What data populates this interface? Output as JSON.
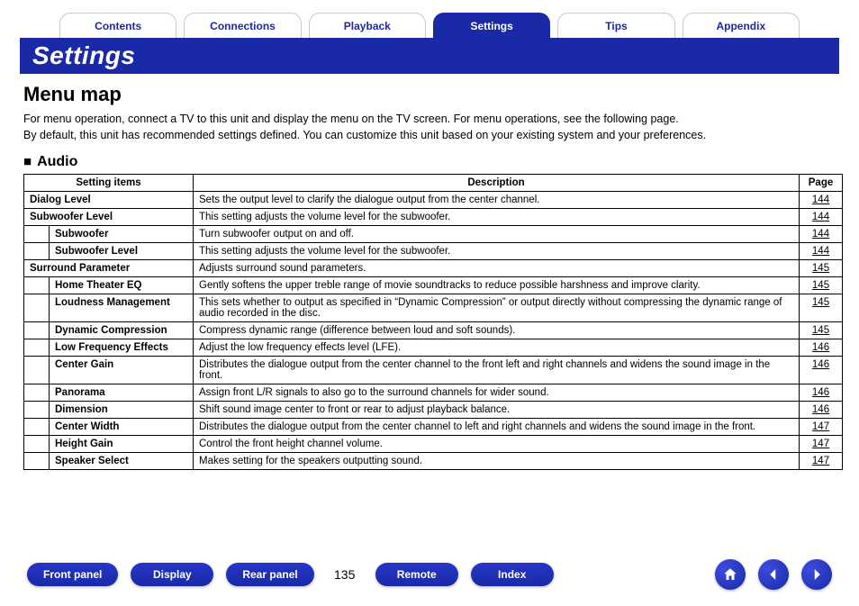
{
  "tabs": {
    "contents": "Contents",
    "connections": "Connections",
    "playback": "Playback",
    "settings": "Settings",
    "tips": "Tips",
    "appendix": "Appendix",
    "active": "settings"
  },
  "title_band": "Settings",
  "section_title": "Menu map",
  "intro_line1": "For menu operation, connect a TV to this unit and display the menu on the TV screen. For menu operations, see the following page.",
  "intro_line2": "By default, this unit has recommended settings defined. You can customize this unit based on your existing system and your preferences.",
  "audio_heading": "Audio",
  "table_headers": {
    "items": "Setting items",
    "description": "Description",
    "page": "Page"
  },
  "rows": [
    {
      "indent": 0,
      "item": "Dialog Level",
      "desc": "Sets the output level to clarify the dialogue output from the center channel.",
      "page": "144"
    },
    {
      "indent": 0,
      "item": "Subwoofer Level",
      "desc": "This setting adjusts the volume level for the subwoofer.",
      "page": "144"
    },
    {
      "indent": 1,
      "item": "Subwoofer",
      "desc": "Turn subwoofer output on and off.",
      "page": "144"
    },
    {
      "indent": 1,
      "item": "Subwoofer Level",
      "desc": "This setting adjusts the volume level for the subwoofer.",
      "page": "144"
    },
    {
      "indent": 0,
      "item": "Surround Parameter",
      "desc": "Adjusts surround sound parameters.",
      "page": "145"
    },
    {
      "indent": 1,
      "item": "Home Theater EQ",
      "desc": "Gently softens the upper treble range of movie soundtracks to reduce possible harshness and improve clarity.",
      "page": "145"
    },
    {
      "indent": 1,
      "item": "Loudness Management",
      "desc": "This sets whether to output as specified in “Dynamic Compression” or output directly without compressing the dynamic range of audio recorded in the disc.",
      "page": "145"
    },
    {
      "indent": 1,
      "item": "Dynamic Compression",
      "desc": "Compress dynamic range (difference between loud and soft sounds).",
      "page": "145"
    },
    {
      "indent": 1,
      "item": "Low Frequency Effects",
      "desc": "Adjust the low frequency effects level (LFE).",
      "page": "146"
    },
    {
      "indent": 1,
      "item": "Center Gain",
      "desc": "Distributes the dialogue output from the center channel to the front left and right channels and widens the sound image in the front.",
      "page": "146"
    },
    {
      "indent": 1,
      "item": "Panorama",
      "desc": "Assign front L/R signals to also go to the surround channels for wider sound.",
      "page": "146"
    },
    {
      "indent": 1,
      "item": "Dimension",
      "desc": "Shift sound image center to front or rear to adjust playback balance.",
      "page": "146"
    },
    {
      "indent": 1,
      "item": "Center Width",
      "desc": "Distributes the dialogue output from the center channel to left and right channels and widens the sound image in the front.",
      "page": "147"
    },
    {
      "indent": 1,
      "item": "Height Gain",
      "desc": "Control the front height channel volume.",
      "page": "147"
    },
    {
      "indent": 1,
      "item": "Speaker Select",
      "desc": "Makes setting for the speakers outputting sound.",
      "page": "147"
    }
  ],
  "footer": {
    "front_panel": "Front panel",
    "display": "Display",
    "rear_panel": "Rear panel",
    "remote": "Remote",
    "index": "Index",
    "page_number": "135"
  }
}
